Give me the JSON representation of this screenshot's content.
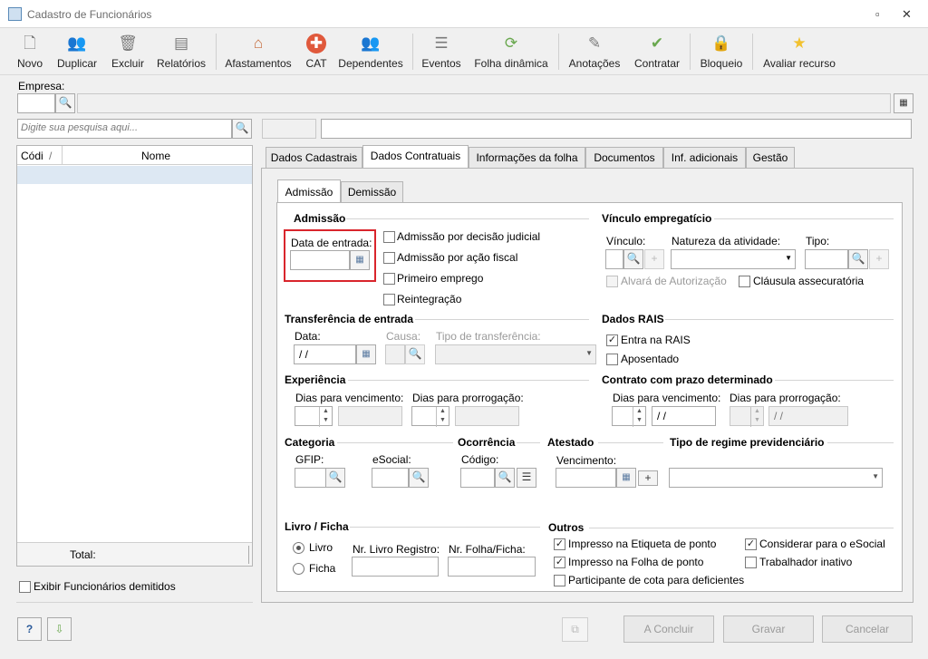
{
  "window": {
    "title": "Cadastro de Funcionários",
    "min": "▫",
    "close": "✕"
  },
  "toolbar": [
    {
      "label": "Novo",
      "icon": "new-document-icon",
      "glyph": "🗋"
    },
    {
      "label": "Duplicar",
      "icon": "duplicate-users-icon",
      "glyph": "👥"
    },
    {
      "label": "Excluir",
      "icon": "trash-icon",
      "glyph": "🗑"
    },
    {
      "label": "Relatórios",
      "icon": "report-icon",
      "glyph": "▤"
    },
    {
      "label": "Afastamentos",
      "icon": "house-arrow-icon",
      "glyph": "⌂"
    },
    {
      "label": "CAT",
      "icon": "medical-cross-icon",
      "glyph": "✚"
    },
    {
      "label": "Dependentes",
      "icon": "dependents-icon",
      "glyph": "👥"
    },
    {
      "label": "Eventos",
      "icon": "events-list-icon",
      "glyph": "☰"
    },
    {
      "label": "Folha dinâmica",
      "icon": "dynamic-sheet-icon",
      "glyph": "⟳"
    },
    {
      "label": "Anotações",
      "icon": "notes-icon",
      "glyph": "✎"
    },
    {
      "label": "Contratar",
      "icon": "hire-icon",
      "glyph": "✔"
    },
    {
      "label": "Bloqueio",
      "icon": "lock-icon",
      "glyph": "🔒"
    },
    {
      "label": "Avaliar recurso",
      "icon": "star-icon",
      "glyph": "★"
    }
  ],
  "empresa": {
    "label": "Empresa:"
  },
  "search": {
    "placeholder": "Digite sua pesquisa aqui..."
  },
  "grid": {
    "col_code": "Códi",
    "sort": "/",
    "col_name": "Nome",
    "total": "Total:"
  },
  "show_dismissed": "Exibir Funcionários demitidos",
  "tabs": [
    "Dados Cadastrais",
    "Dados Contratuais",
    "Informações da folha",
    "Documentos",
    "Inf. adicionais",
    "Gestão"
  ],
  "subtabs": [
    "Admissão",
    "Demissão"
  ],
  "admissao": {
    "title": "Admissão",
    "data_entrada": "Data de entrada:",
    "checks": [
      "Admissão por decisão judicial",
      "Admissão por ação fiscal",
      "Primeiro emprego",
      "Reintegração"
    ]
  },
  "vinculo": {
    "title": "Vínculo empregatício",
    "vinculo": "Vínculo:",
    "natureza": "Natureza da atividade:",
    "tipo": "Tipo:",
    "alvara": "Alvará de Autorização",
    "clausula": "Cláusula assecuratória"
  },
  "transferencia": {
    "title": "Transferência de entrada",
    "data": "Data:",
    "data_value": " /  /",
    "causa": "Causa:",
    "tipo": "Tipo de transferência:"
  },
  "rais": {
    "title": "Dados RAIS",
    "entra": "Entra na RAIS",
    "aposentado": "Aposentado"
  },
  "experiencia": {
    "title": "Experiência",
    "dias_venc": "Dias para vencimento:",
    "dias_prorr": "Dias para prorrogação:"
  },
  "contrato": {
    "title": "Contrato com prazo determinado",
    "dias_venc": "Dias para vencimento:",
    "dias_prorr": "Dias para prorrogação:",
    "date1": " /  /",
    "date2": " /  /"
  },
  "categoria": {
    "title": "Categoria",
    "gfip": "GFIP:",
    "esocial": "eSocial:"
  },
  "ocorrencia": {
    "title": "Ocorrência",
    "codigo": "Código:"
  },
  "atestado": {
    "title": "Atestado",
    "vencimento": "Vencimento:"
  },
  "regime": {
    "title": "Tipo de regime previdenciário"
  },
  "livro": {
    "title": "Livro / Ficha",
    "livro": "Livro",
    "ficha": "Ficha",
    "nr_livro": "Nr. Livro Registro:",
    "nr_folha": "Nr. Folha/Ficha:"
  },
  "outros": {
    "title": "Outros",
    "etiqueta": "Impresso na Etiqueta de ponto",
    "folha": "Impresso na Folha de ponto",
    "cota": "Participante de cota para deficientes",
    "esocial": "Considerar para o eSocial",
    "inativo": "Trabalhador inativo"
  },
  "footer": {
    "help": "?",
    "concluir": "A Concluir",
    "gravar": "Gravar",
    "cancelar": "Cancelar"
  },
  "colors": {
    "highlight": "#d9252c",
    "grid_select": "#dde8f3"
  }
}
